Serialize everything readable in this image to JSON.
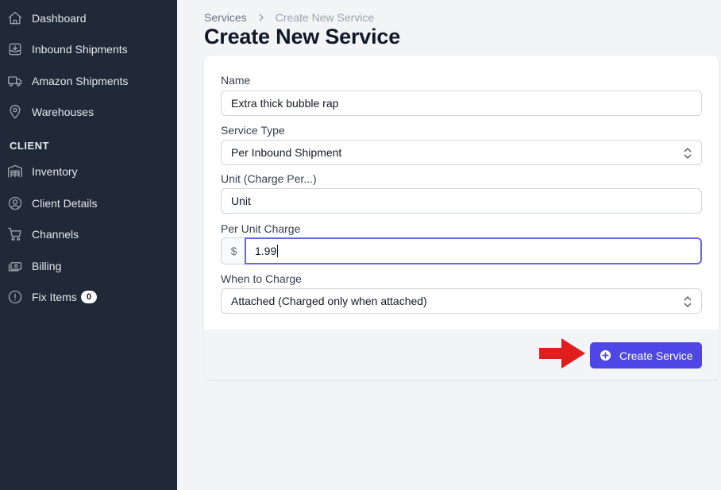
{
  "sidebar": {
    "items": [
      {
        "label": "Dashboard",
        "icon": "home-icon"
      },
      {
        "label": "Inbound Shipments",
        "icon": "inbox-download-icon"
      },
      {
        "label": "Amazon Shipments",
        "icon": "truck-icon"
      },
      {
        "label": "Warehouses",
        "icon": "map-pin-icon"
      }
    ],
    "section_heading": "CLIENT",
    "client_items": [
      {
        "label": "Inventory",
        "icon": "warehouse-shelves-icon"
      },
      {
        "label": "Client Details",
        "icon": "user-circle-icon"
      },
      {
        "label": "Channels",
        "icon": "shopping-cart-icon"
      },
      {
        "label": "Billing",
        "icon": "cash-icon"
      },
      {
        "label": "Fix Items",
        "icon": "exclamation-circle-icon",
        "badge": "0"
      }
    ]
  },
  "breadcrumb": {
    "parent": "Services",
    "separator": ">",
    "current": "Create New Service"
  },
  "page_title": "Create New Service",
  "form": {
    "name": {
      "label": "Name",
      "value": "Extra thick bubble rap"
    },
    "service_type": {
      "label": "Service Type",
      "value": "Per Inbound Shipment"
    },
    "unit": {
      "label": "Unit (Charge Per...)",
      "value": "Unit"
    },
    "per_unit_charge": {
      "label": "Per Unit Charge",
      "prefix": "$",
      "value": "1.99"
    },
    "when_to_charge": {
      "label": "When to Charge",
      "value": "Attached (Charged only when attached)"
    }
  },
  "actions": {
    "create_label": "Create Service"
  },
  "colors": {
    "sidebar_bg": "#1f2937",
    "accent": "#4f46e5",
    "focus_ring": "#6366f1",
    "annotation_arrow": "#e11d1d"
  }
}
